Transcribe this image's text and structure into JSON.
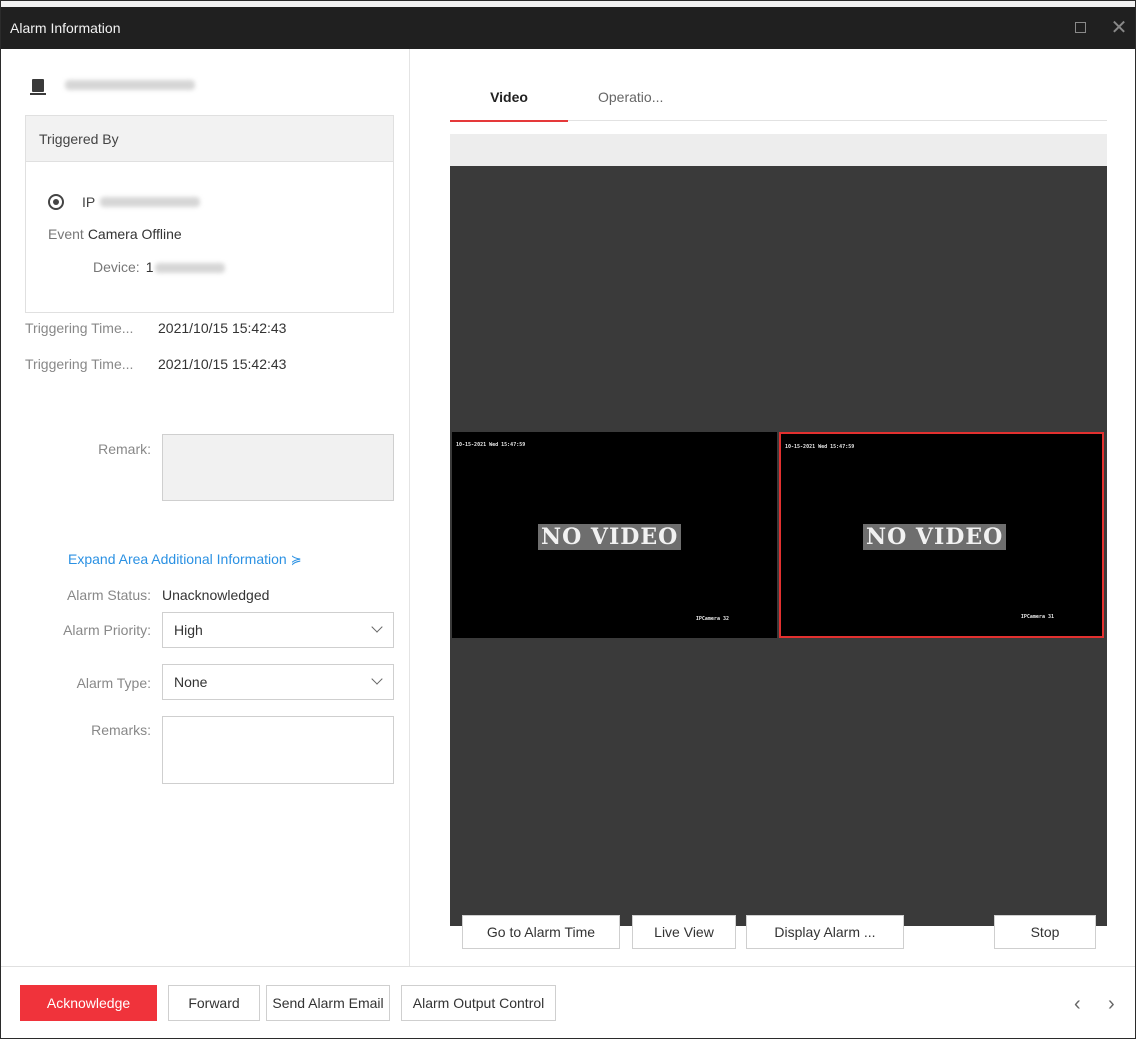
{
  "window": {
    "title": "Alarm Information"
  },
  "triggered": {
    "header": "Triggered By",
    "camera_prefix": "IP",
    "event_label": "Event",
    "event_value": "Camera Offline",
    "device_label": "Device:",
    "device_prefix": "1"
  },
  "times": [
    {
      "label": "Triggering Time...",
      "value": "2021/10/15 15:42:43"
    },
    {
      "label": "Triggering Time...",
      "value": "2021/10/15 15:42:43"
    }
  ],
  "remark_label": "Remark:",
  "expand": {
    "label": "Expand Area Additional Information",
    "chevron": "≽"
  },
  "status": {
    "label": "Alarm Status:",
    "value": "Unacknowledged"
  },
  "priority": {
    "label": "Alarm Priority:",
    "value": "High"
  },
  "type": {
    "label": "Alarm Type:",
    "value": "None"
  },
  "remarks_label": "Remarks:",
  "tabs": [
    {
      "label": "Video",
      "active": true
    },
    {
      "label": "Operatio...",
      "active": false
    }
  ],
  "video": {
    "tiles": [
      {
        "osd": "10-15-2021 Wed 15:47:59",
        "message": "NO VIDEO",
        "camera": "IPCamera 32",
        "selected": false
      },
      {
        "osd": "10-15-2021 Wed 15:47:59",
        "message": "NO VIDEO",
        "camera": "IPCamera 31",
        "selected": true
      }
    ]
  },
  "player_buttons": {
    "alarm_time": "Go to Alarm Time",
    "live_view": "Live View",
    "display_alarm": "Display Alarm ...",
    "stop": "Stop"
  },
  "bottom": {
    "acknowledge": "Acknowledge",
    "forward": "Forward",
    "send_email": "Send Alarm Email",
    "output_control": "Alarm Output Control",
    "prev": "‹",
    "next": "›"
  },
  "colors": {
    "accent_red": "#f0333b",
    "link_blue": "#2b91e3",
    "titlebar": "#202020",
    "player_bg": "#3a3a3a"
  }
}
